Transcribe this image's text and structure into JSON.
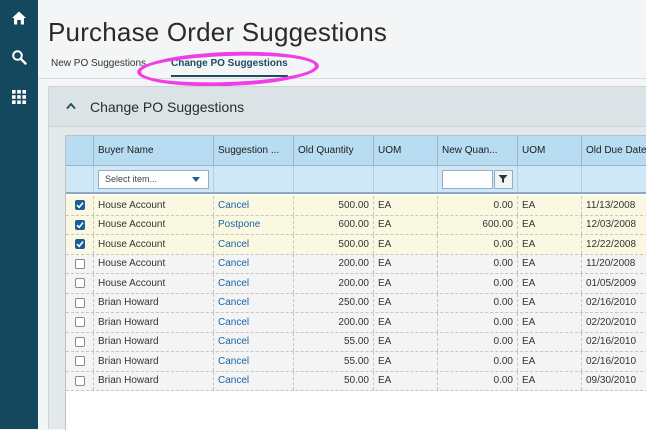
{
  "page": {
    "title": "Purchase Order Suggestions"
  },
  "tabs": [
    {
      "label": "New PO Suggestions"
    },
    {
      "label": "Change PO Suggestions"
    }
  ],
  "panel": {
    "title": "Change PO Suggestions"
  },
  "grid": {
    "columns": [
      "Buyer Name",
      "Suggestion ...",
      "Old Quantity",
      "UOM",
      "New Quan...",
      "UOM",
      "Old Due Date"
    ],
    "filter": {
      "placeholder": "Select item..."
    },
    "rows": [
      {
        "checked": true,
        "buyer": "House Account",
        "suggestion": "Cancel",
        "old_qty": "500.00",
        "uom": "EA",
        "new_qty": "0.00",
        "uom2": "EA",
        "old_due": "11/13/2008"
      },
      {
        "checked": true,
        "buyer": "House Account",
        "suggestion": "Postpone",
        "old_qty": "600.00",
        "uom": "EA",
        "new_qty": "600.00",
        "uom2": "EA",
        "old_due": "12/03/2008"
      },
      {
        "checked": true,
        "buyer": "House Account",
        "suggestion": "Cancel",
        "old_qty": "500.00",
        "uom": "EA",
        "new_qty": "0.00",
        "uom2": "EA",
        "old_due": "12/22/2008"
      },
      {
        "checked": false,
        "buyer": "House Account",
        "suggestion": "Cancel",
        "old_qty": "200.00",
        "uom": "EA",
        "new_qty": "0.00",
        "uom2": "EA",
        "old_due": "11/20/2008"
      },
      {
        "checked": false,
        "buyer": "House Account",
        "suggestion": "Cancel",
        "old_qty": "200.00",
        "uom": "EA",
        "new_qty": "0.00",
        "uom2": "EA",
        "old_due": "01/05/2009"
      },
      {
        "checked": false,
        "buyer": "Brian Howard",
        "suggestion": "Cancel",
        "old_qty": "250.00",
        "uom": "EA",
        "new_qty": "0.00",
        "uom2": "EA",
        "old_due": "02/16/2010"
      },
      {
        "checked": false,
        "buyer": "Brian Howard",
        "suggestion": "Cancel",
        "old_qty": "200.00",
        "uom": "EA",
        "new_qty": "0.00",
        "uom2": "EA",
        "old_due": "02/20/2010"
      },
      {
        "checked": false,
        "buyer": "Brian Howard",
        "suggestion": "Cancel",
        "old_qty": "55.00",
        "uom": "EA",
        "new_qty": "0.00",
        "uom2": "EA",
        "old_due": "02/16/2010"
      },
      {
        "checked": false,
        "buyer": "Brian Howard",
        "suggestion": "Cancel",
        "old_qty": "55.00",
        "uom": "EA",
        "new_qty": "0.00",
        "uom2": "EA",
        "old_due": "02/16/2010"
      },
      {
        "checked": false,
        "buyer": "Brian Howard",
        "suggestion": "Cancel",
        "old_qty": "50.00",
        "uom": "EA",
        "new_qty": "0.00",
        "uom2": "EA",
        "old_due": "09/30/2010"
      }
    ]
  },
  "icons": {
    "home": "home-icon",
    "search": "search-icon",
    "apps": "apps-grid-icon",
    "collapse": "chevron-up-icon",
    "filter": "filter-icon",
    "dropdown": "chevron-down-icon",
    "check": "check-icon"
  },
  "colors": {
    "sidebar": "#14485e",
    "header": "#b8dcf2",
    "selected_row": "#fbf8e2",
    "link": "#1a64a8",
    "highlight": "#ef3de8",
    "checkbox": "#1a5f9a"
  }
}
